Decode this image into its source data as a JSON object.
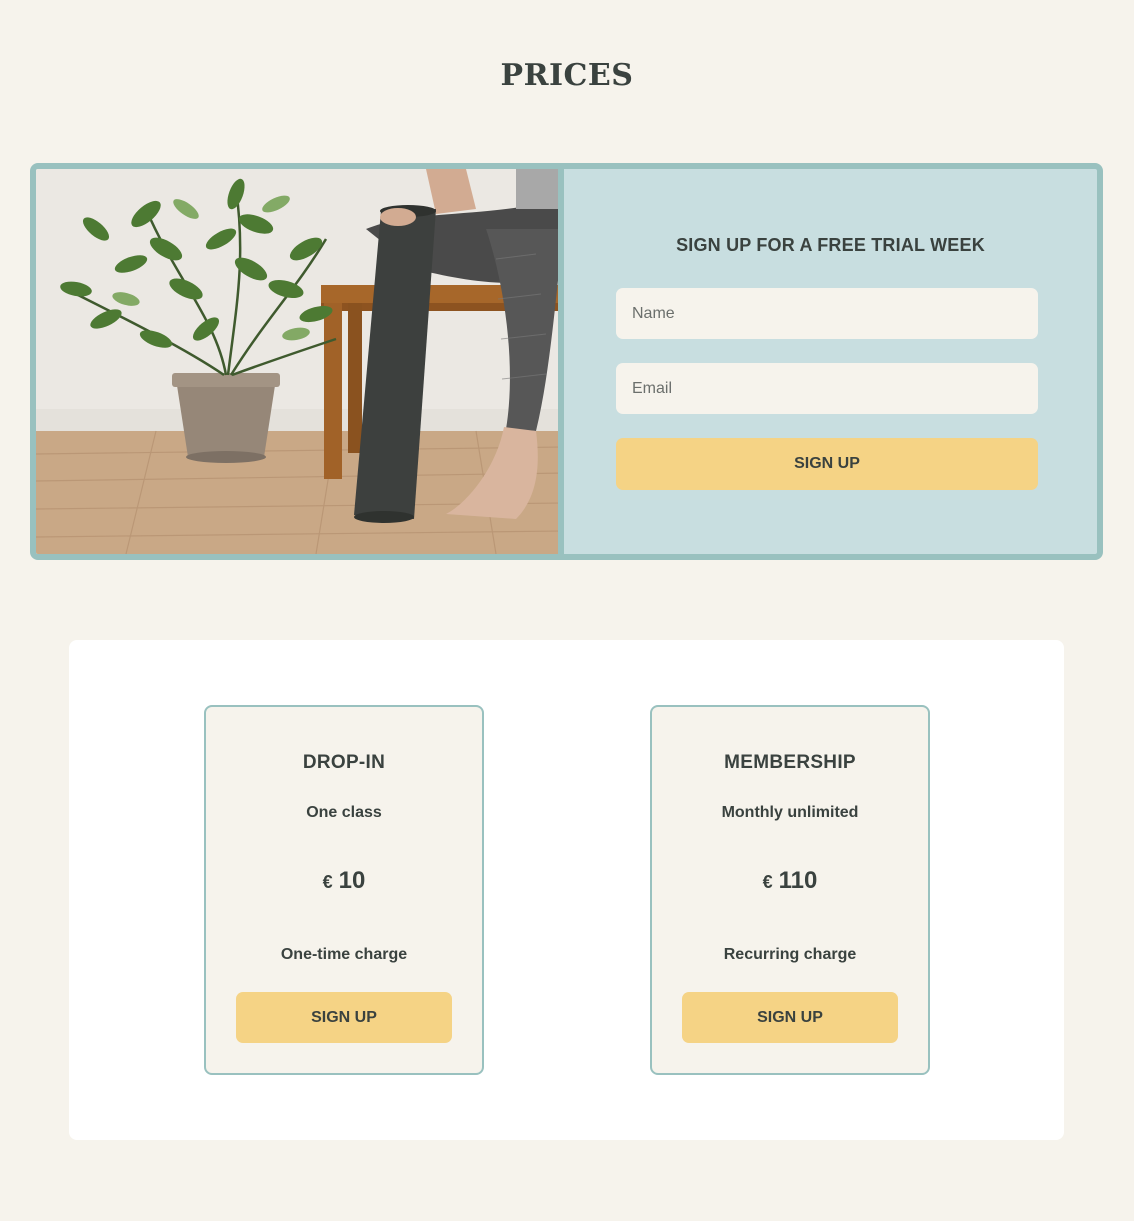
{
  "page": {
    "title": "PRICES"
  },
  "trial": {
    "heading": "SIGN UP FOR A FREE TRIAL WEEK",
    "name_placeholder": "Name",
    "email_placeholder": "Email",
    "button_label": "SIGN UP",
    "photo": "yoga-mat-plant-photo"
  },
  "plans": [
    {
      "name": "DROP-IN",
      "subtitle": "One class",
      "currency": "€",
      "price": "10",
      "charge": "One-time charge",
      "button_label": "SIGN UP"
    },
    {
      "name": "MEMBERSHIP",
      "subtitle": "Monthly unlimited",
      "currency": "€",
      "price": "110",
      "charge": "Recurring charge",
      "button_label": "SIGN UP"
    }
  ],
  "colors": {
    "background": "#f6f3ec",
    "accent_border": "#99c1bf",
    "panel": "#c8dee0",
    "button": "#f5d385",
    "text": "#3a423f"
  }
}
